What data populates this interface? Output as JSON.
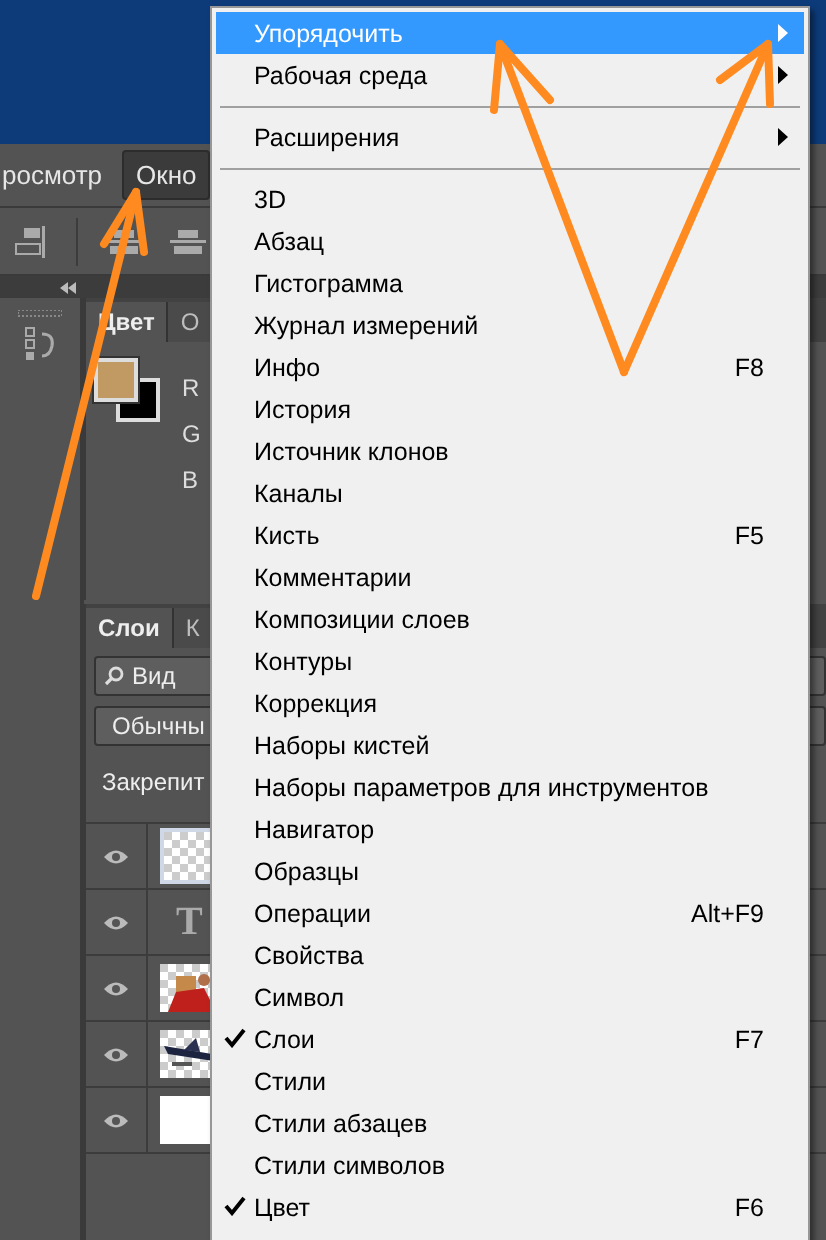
{
  "menubar": {
    "items": [
      {
        "label": "росмотр",
        "selected": false
      },
      {
        "label": "Окно",
        "selected": true
      }
    ]
  },
  "color_panel": {
    "tabs": [
      {
        "label": "Цвет",
        "selected": true
      },
      {
        "label": "О",
        "selected": false
      }
    ],
    "channels": [
      "R",
      "G",
      "B"
    ]
  },
  "layers_panel": {
    "tabs": [
      {
        "label": "Слои",
        "selected": true
      },
      {
        "label": "К",
        "selected": false
      }
    ],
    "filter_kind": "Вид",
    "blend_mode": "Обычны",
    "lock_label": "Закрепит",
    "layers": [
      {
        "kind": "transparent",
        "visible": true,
        "selected": true
      },
      {
        "kind": "text",
        "glyph": "T",
        "visible": true,
        "selected": false
      },
      {
        "kind": "picture",
        "visible": true,
        "selected": false
      },
      {
        "kind": "picture",
        "visible": true,
        "selected": false
      },
      {
        "kind": "white",
        "visible": true,
        "selected": false
      }
    ]
  },
  "window_menu": {
    "items": [
      {
        "kind": "item",
        "label": "Упорядочить",
        "submenu": true,
        "selected": true,
        "checked": false
      },
      {
        "kind": "item",
        "label": "Рабочая среда",
        "submenu": true,
        "selected": false,
        "checked": false
      },
      {
        "kind": "separator"
      },
      {
        "kind": "item",
        "label": "Расширения",
        "submenu": true,
        "selected": false,
        "checked": false
      },
      {
        "kind": "separator"
      },
      {
        "kind": "item",
        "label": "3D",
        "selected": false,
        "checked": false
      },
      {
        "kind": "item",
        "label": "Абзац",
        "selected": false,
        "checked": false
      },
      {
        "kind": "item",
        "label": "Гистограмма",
        "selected": false,
        "checked": false
      },
      {
        "kind": "item",
        "label": "Журнал измерений",
        "selected": false,
        "checked": false
      },
      {
        "kind": "item",
        "label": "Инфо",
        "shortcut": "F8",
        "selected": false,
        "checked": false
      },
      {
        "kind": "item",
        "label": "История",
        "selected": false,
        "checked": false
      },
      {
        "kind": "item",
        "label": "Источник клонов",
        "selected": false,
        "checked": false
      },
      {
        "kind": "item",
        "label": "Каналы",
        "selected": false,
        "checked": false
      },
      {
        "kind": "item",
        "label": "Кисть",
        "shortcut": "F5",
        "selected": false,
        "checked": false
      },
      {
        "kind": "item",
        "label": "Комментарии",
        "selected": false,
        "checked": false
      },
      {
        "kind": "item",
        "label": "Композиции слоев",
        "selected": false,
        "checked": false
      },
      {
        "kind": "item",
        "label": "Контуры",
        "selected": false,
        "checked": false
      },
      {
        "kind": "item",
        "label": "Коррекция",
        "selected": false,
        "checked": false
      },
      {
        "kind": "item",
        "label": "Наборы кистей",
        "selected": false,
        "checked": false
      },
      {
        "kind": "item",
        "label": "Наборы параметров для инструментов",
        "selected": false,
        "checked": false
      },
      {
        "kind": "item",
        "label": "Навигатор",
        "selected": false,
        "checked": false
      },
      {
        "kind": "item",
        "label": "Образцы",
        "selected": false,
        "checked": false
      },
      {
        "kind": "item",
        "label": "Операции",
        "shortcut": "Alt+F9",
        "selected": false,
        "checked": false
      },
      {
        "kind": "item",
        "label": "Свойства",
        "selected": false,
        "checked": false
      },
      {
        "kind": "item",
        "label": "Символ",
        "selected": false,
        "checked": false
      },
      {
        "kind": "item",
        "label": "Слои",
        "shortcut": "F7",
        "selected": false,
        "checked": true
      },
      {
        "kind": "item",
        "label": "Стили",
        "selected": false,
        "checked": false
      },
      {
        "kind": "item",
        "label": "Стили абзацев",
        "selected": false,
        "checked": false
      },
      {
        "kind": "item",
        "label": "Стили символов",
        "selected": false,
        "checked": false
      },
      {
        "kind": "item",
        "label": "Цвет",
        "shortcut": "F6",
        "selected": false,
        "checked": true
      }
    ]
  }
}
